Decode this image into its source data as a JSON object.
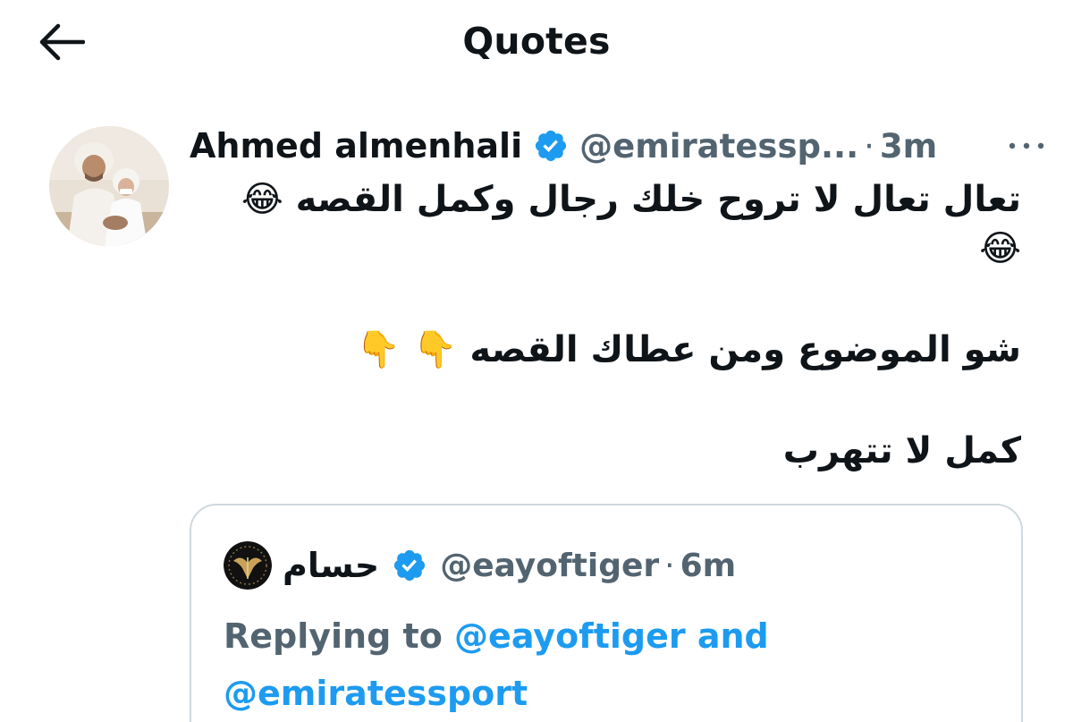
{
  "header": {
    "title": "Quotes",
    "back_icon": "arrow-left-icon"
  },
  "tweet": {
    "author_name": "Ahmed almenhali",
    "handle": "@emiratessp...",
    "separator": "·",
    "time": "3m",
    "more_icon": "more-dots-icon",
    "lines": [
      "تعال تعال لا تروح خلك رجال وكمل القصه 😂 😂",
      "شو الموضوع ومن عطاك القصه 👇 👇",
      "كمل لا تتهرب"
    ]
  },
  "quote": {
    "author_name": "حسام",
    "handle": "@eayoftiger",
    "separator": "·",
    "time": "6m",
    "replying_prefix": "Replying to",
    "replying_handle_1": "@eayoftiger",
    "replying_and": "and",
    "replying_handle_2": "@emiratessport"
  },
  "colors": {
    "text": "#0f1419",
    "secondary": "#536471",
    "link": "#1d9bf0",
    "border": "#cfd9de"
  }
}
